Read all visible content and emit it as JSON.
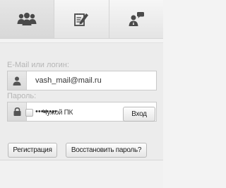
{
  "tabs": [
    {
      "icon": "users-icon"
    },
    {
      "icon": "edit-note-icon"
    },
    {
      "icon": "user-chat-icon"
    }
  ],
  "login": {
    "email_label": "E-Mail или логин:",
    "email_value": "vash_mail@mail.ru",
    "password_label": "Пароль:",
    "password_value": "12345678",
    "remember_label": "Чужой ПК",
    "submit_label": "Вход"
  },
  "footer": {
    "register_label": "Регистрация",
    "restore_label": "Восстановить пароль?"
  },
  "colors": {
    "icon": "#4a4a4a",
    "label": "#b5b5b5",
    "panel": "#ececec"
  }
}
